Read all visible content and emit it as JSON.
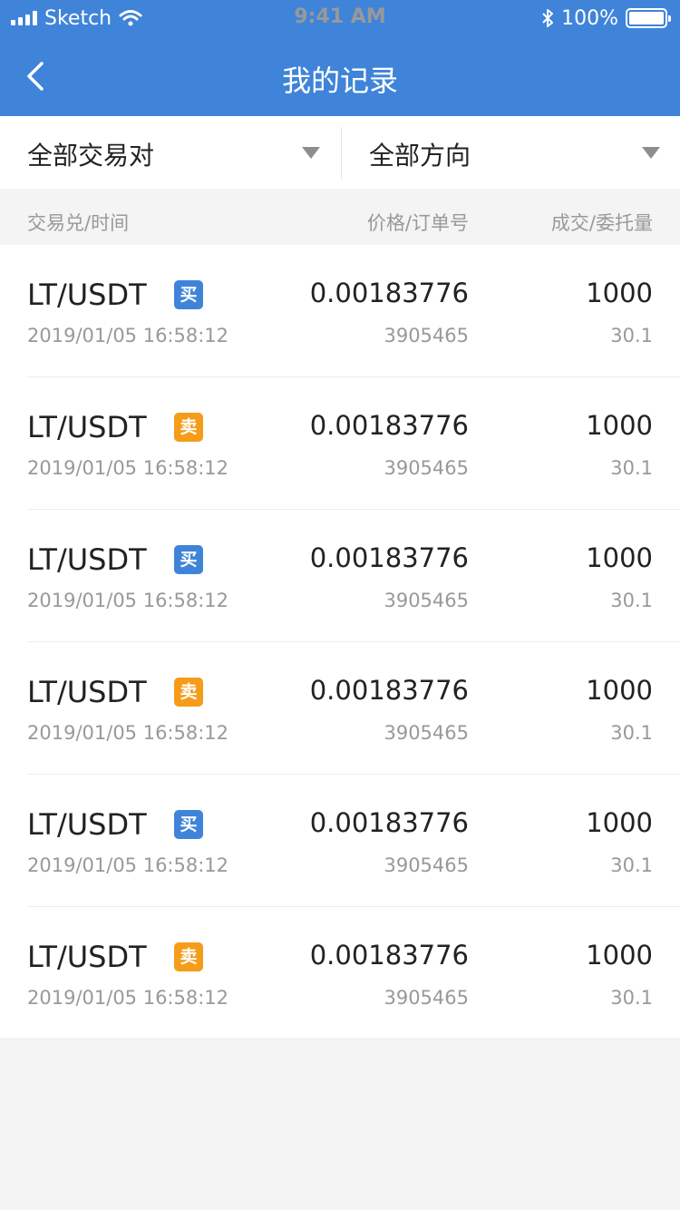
{
  "status_bar": {
    "carrier": "Sketch",
    "time": "9:41 AM",
    "battery": "100%",
    "signal_icon": "signal-bars-icon",
    "wifi_icon": "wifi-icon",
    "bluetooth_icon": "bluetooth-icon",
    "battery_icon": "battery-icon"
  },
  "nav": {
    "title": "我的记录",
    "back_icon": "chevron-left-icon"
  },
  "filters": [
    {
      "label": "全部交易对",
      "icon": "triangle-down-icon"
    },
    {
      "label": "全部方向",
      "icon": "triangle-down-icon"
    }
  ],
  "columns": {
    "pair_time": "交易兑/时间",
    "price_order": "价格/订单号",
    "deal_qty": "成交/委托量"
  },
  "records": [
    {
      "pair": "LT/USDT",
      "side": "买",
      "side_type": "buy",
      "time": "2019/01/05 16:58:12",
      "price": "0.00183776",
      "order": "3905465",
      "deal": "1000",
      "qty": "30.1"
    },
    {
      "pair": "LT/USDT",
      "side": "卖",
      "side_type": "sell",
      "time": "2019/01/05 16:58:12",
      "price": "0.00183776",
      "order": "3905465",
      "deal": "1000",
      "qty": "30.1"
    },
    {
      "pair": "LT/USDT",
      "side": "买",
      "side_type": "buy",
      "time": "2019/01/05 16:58:12",
      "price": "0.00183776",
      "order": "3905465",
      "deal": "1000",
      "qty": "30.1"
    },
    {
      "pair": "LT/USDT",
      "side": "卖",
      "side_type": "sell",
      "time": "2019/01/05 16:58:12",
      "price": "0.00183776",
      "order": "3905465",
      "deal": "1000",
      "qty": "30.1"
    },
    {
      "pair": "LT/USDT",
      "side": "买",
      "side_type": "buy",
      "time": "2019/01/05 16:58:12",
      "price": "0.00183776",
      "order": "3905465",
      "deal": "1000",
      "qty": "30.1"
    },
    {
      "pair": "LT/USDT",
      "side": "卖",
      "side_type": "sell",
      "time": "2019/01/05 16:58:12",
      "price": "0.00183776",
      "order": "3905465",
      "deal": "1000",
      "qty": "30.1"
    }
  ],
  "colors": {
    "primary": "#3f84d9",
    "buy": "#3f84d9",
    "sell": "#f59c1a",
    "background": "#f4f4f4"
  }
}
